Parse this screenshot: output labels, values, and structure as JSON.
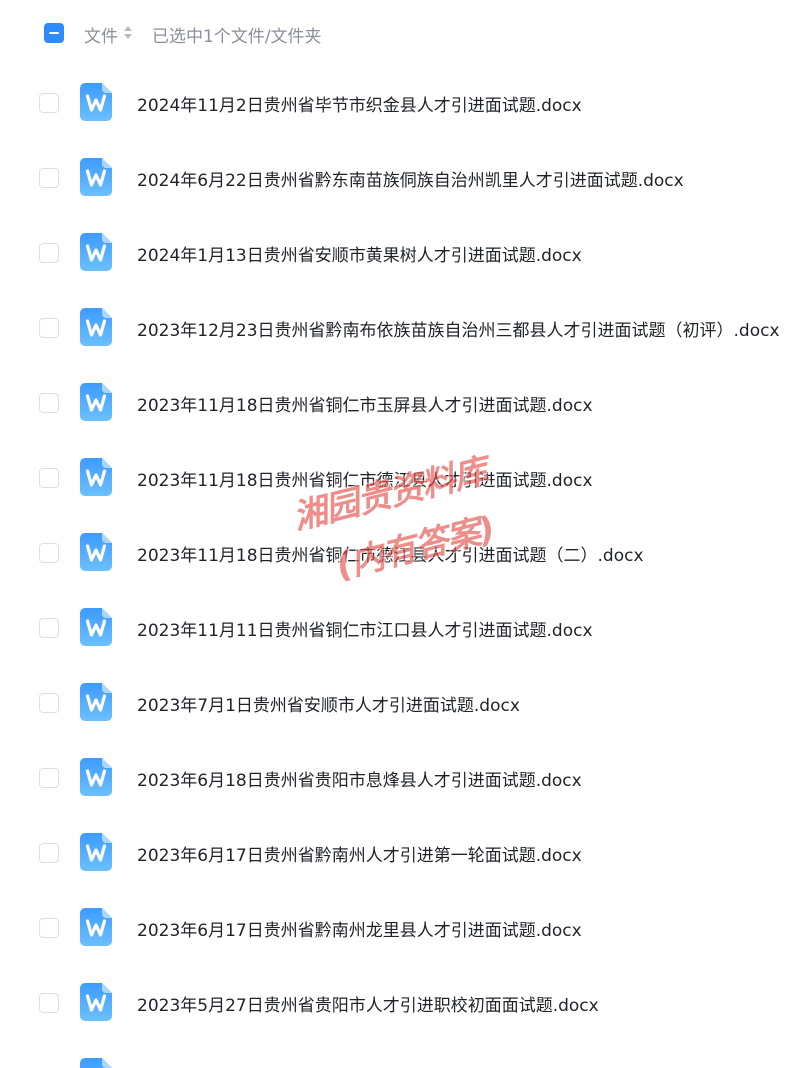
{
  "header": {
    "column_title": "文件",
    "selection_status": "已选中1个文件/文件夹",
    "select_all_state": "indeterminate"
  },
  "colors": {
    "accent": "#2b8cff",
    "doc_icon": "#4aa8ff",
    "watermark": "#e44a44"
  },
  "files": [
    {
      "name": "2024年11月2日贵州省毕节市织金县人才引进面试题.docx"
    },
    {
      "name": "2024年6月22日贵州省黔东南苗族侗族自治州凯里人才引进面试题.docx"
    },
    {
      "name": "2024年1月13日贵州省安顺市黄果树人才引进面试题.docx"
    },
    {
      "name": "2023年12月23日贵州省黔南布依族苗族自治州三都县人才引进面试题（初评）.docx"
    },
    {
      "name": "2023年11月18日贵州省铜仁市玉屏县人才引进面试题.docx"
    },
    {
      "name": "2023年11月18日贵州省铜仁市德江县人才引进面试题.docx"
    },
    {
      "name": "2023年11月18日贵州省铜仁市德江县人才引进面试题（二）.docx"
    },
    {
      "name": "2023年11月11日贵州省铜仁市江口县人才引进面试题.docx"
    },
    {
      "name": "2023年7月1日贵州省安顺市人才引进面试题.docx"
    },
    {
      "name": "2023年6月18日贵州省贵阳市息烽县人才引进面试题.docx"
    },
    {
      "name": "2023年6月17日贵州省黔南州人才引进第一轮面试题.docx"
    },
    {
      "name": "2023年6月17日贵州省黔南州龙里县人才引进面试题.docx"
    },
    {
      "name": "2023年5月27日贵州省贵阳市人才引进职校初面面试题.docx"
    },
    {
      "name": ""
    }
  ],
  "watermark": {
    "line1": "湘园贵资料库",
    "line2": "(内有答案)"
  }
}
